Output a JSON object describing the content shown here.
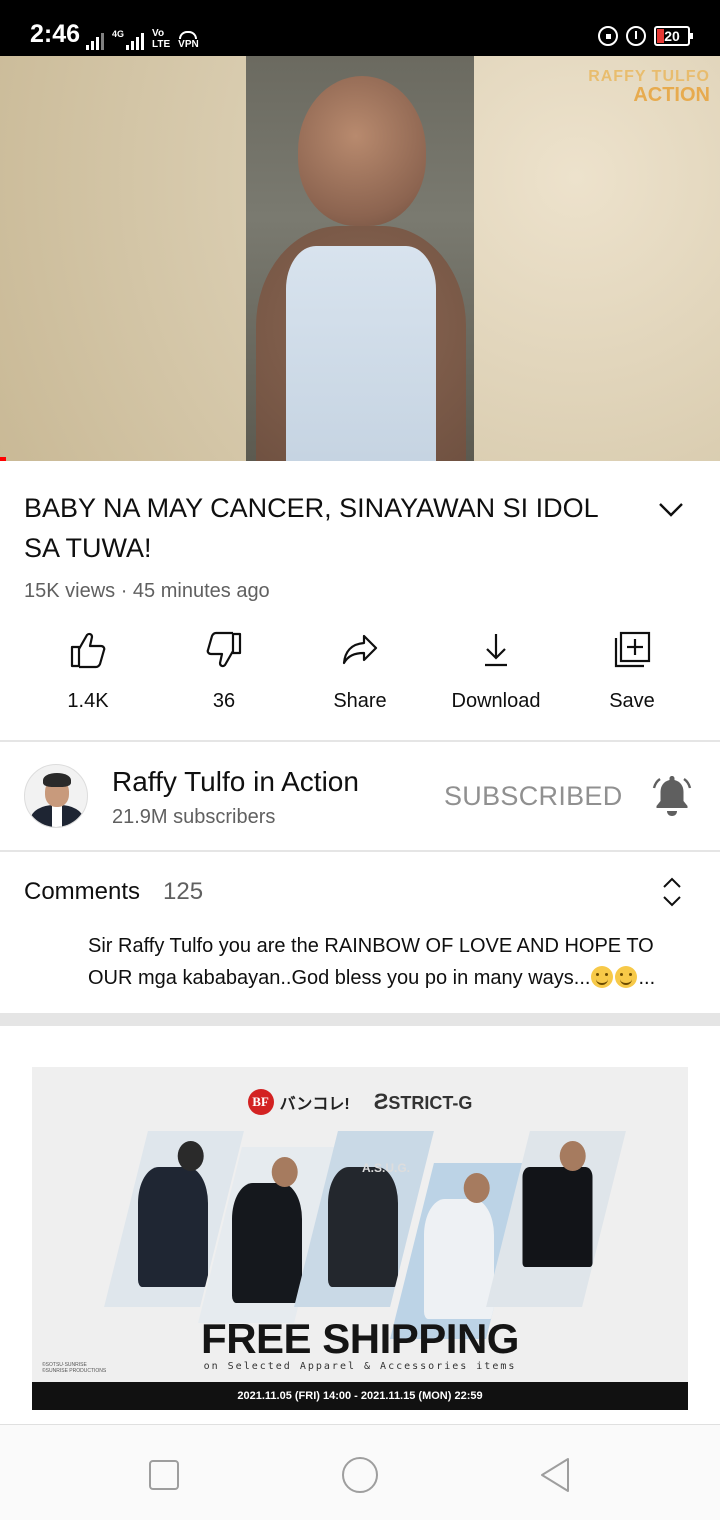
{
  "status_bar": {
    "time": "2:46",
    "network_label": "4G",
    "volte_top": "Vo",
    "volte_bottom": "LTE",
    "vpn_label": "VPN",
    "battery": "20",
    "icons": [
      "signal-icon",
      "signal-4g-icon",
      "volte-icon",
      "vpn-icon",
      "lock-rotation-icon",
      "alarm-icon",
      "battery-icon"
    ]
  },
  "video": {
    "watermark_line1": "RAFFY TULFO",
    "watermark_line2": "ACTION"
  },
  "video_info": {
    "title": "BABY NA MAY CANCER, SINAYAWAN SI IDOL SA TUWA!",
    "meta": "15K views · 45 minutes ago"
  },
  "actions": [
    {
      "label": "1.4K",
      "icon": "thumbs-up-icon"
    },
    {
      "label": "36",
      "icon": "thumbs-down-icon"
    },
    {
      "label": "Share",
      "icon": "share-icon"
    },
    {
      "label": "Download",
      "icon": "download-icon"
    },
    {
      "label": "Save",
      "icon": "save-playlist-icon"
    }
  ],
  "channel": {
    "name": "Raffy Tulfo in Action",
    "subscribers": "21.9M subscribers",
    "subscribe_state": "SUBSCRIBED"
  },
  "comments": {
    "label": "Comments",
    "count": "125",
    "top_comment": "Sir Raffy Tulfo you are the RAINBOW OF LOVE AND HOPE TO OUR mga kababayan..God bless you po in many ways...",
    "ellipsis": "..."
  },
  "ad": {
    "brand1": "バンコレ!",
    "brand1_badge": "BF",
    "brand2": "STRICT-G",
    "jacket_text": "A.S.U.G.",
    "headline": "FREE SHIPPING",
    "subline": "on Selected Apparel & Accessories items",
    "copyright": "©SOTSU·SUNRISE ©SUNRISE PRODUCTIONS",
    "dates": "2021.11.05 (FRI) 14:00 - 2021.11.15 (MON) 22:59"
  },
  "colors": {
    "accent_red": "#ff0000",
    "text_primary": "#0f0f0f",
    "text_secondary": "#606060",
    "subscribed_gray": "#909090"
  }
}
